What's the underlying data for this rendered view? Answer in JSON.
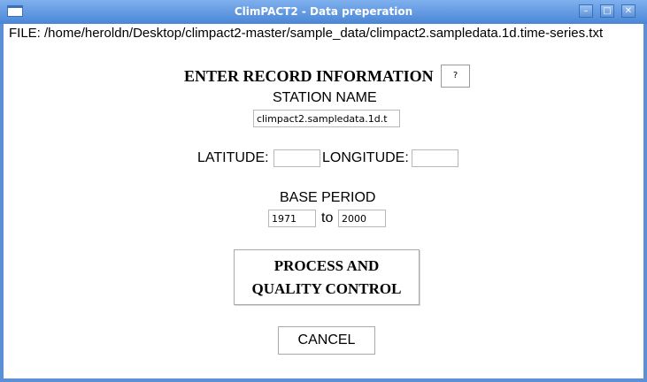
{
  "window": {
    "title": "ClimPACT2 - Data preperation",
    "controls": {
      "minimize": "–",
      "maximize": "□",
      "close": "✕"
    }
  },
  "file": {
    "path_line": "FILE: /home/heroldn/Desktop/climpact2-master/sample_data/climpact2.sampledata.1d.time-series.txt"
  },
  "record": {
    "heading": "ENTER RECORD INFORMATION",
    "help_label": "?",
    "station_name_label": "STATION NAME",
    "station_name_value": "climpact2.sampledata.1d.t",
    "latitude_label": "LATITUDE:",
    "latitude_value": "",
    "longitude_label": "LONGITUDE:",
    "longitude_value": "",
    "base_period_label": "BASE PERIOD",
    "base_start": "1971",
    "to_label": "to",
    "base_end": "2000"
  },
  "actions": {
    "process_line1": "PROCESS AND",
    "process_line2": "QUALITY CONTROL",
    "cancel": "CANCEL"
  },
  "colors": {
    "titlebar": "#4a86d6",
    "window_border": "#5b8fd6"
  }
}
